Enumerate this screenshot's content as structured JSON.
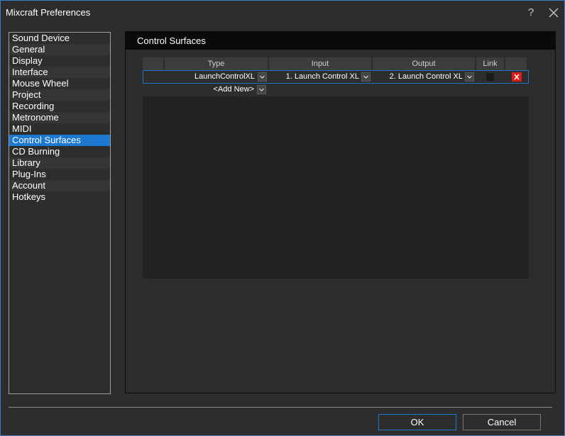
{
  "window": {
    "title": "Mixcraft Preferences",
    "help_label": "?"
  },
  "sidebar": {
    "items": [
      {
        "label": "Sound Device"
      },
      {
        "label": "General"
      },
      {
        "label": "Display"
      },
      {
        "label": "Interface"
      },
      {
        "label": "Mouse Wheel"
      },
      {
        "label": "Project"
      },
      {
        "label": "Recording"
      },
      {
        "label": "Metronome"
      },
      {
        "label": "MIDI"
      },
      {
        "label": "Control Surfaces"
      },
      {
        "label": "CD Burning"
      },
      {
        "label": "Library"
      },
      {
        "label": "Plug-Ins"
      },
      {
        "label": "Account"
      },
      {
        "label": "Hotkeys"
      }
    ],
    "selected": "Control Surfaces"
  },
  "panel": {
    "title": "Control Surfaces"
  },
  "grid": {
    "columns": [
      "Type",
      "Input",
      "Output",
      "Link"
    ],
    "rows": [
      {
        "type": "LaunchControlXL",
        "input": "1. Launch Control XL",
        "output": "2. Launch Control XL",
        "link": false
      }
    ],
    "add_new_label": "<Add New>"
  },
  "buttons": {
    "ok": "OK",
    "cancel": "Cancel"
  },
  "colors": {
    "accent": "#1d78d0",
    "delete": "#e01b1b",
    "header": "#0a0a0a"
  },
  "icons": {
    "close": "close-icon",
    "dropdown": "chevron-down-icon",
    "delete": "delete-x-icon"
  }
}
